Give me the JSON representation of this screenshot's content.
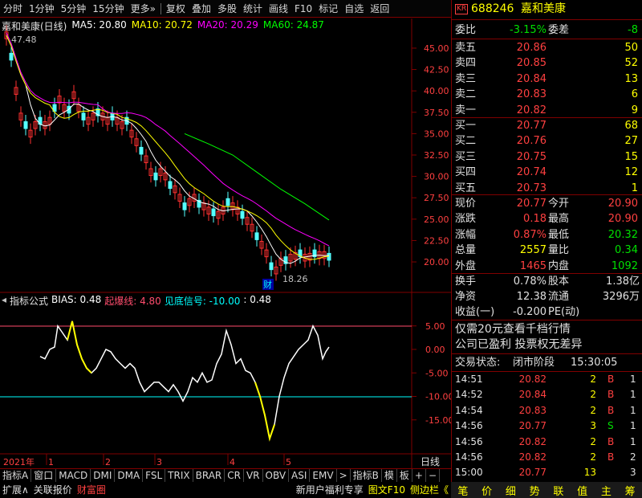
{
  "toolbar": {
    "items": [
      "分时",
      "1分钟",
      "5分钟",
      "15分钟",
      "更多»",
      "复权",
      "叠加",
      "多股",
      "统计",
      "画线",
      "F10",
      "标记",
      "自选",
      "返回"
    ]
  },
  "main_legend": {
    "stock": "嘉和美康(日线)",
    "ma5": "MA5: 20.80",
    "ma10": "MA10: 20.72",
    "ma20": "MA20: 20.29",
    "ma60": "MA60: 24.87",
    "high_label": "47.48",
    "low_label": "18.26",
    "marker": "财"
  },
  "colors": {
    "ma5": "#ffffff",
    "ma10": "#ffff00",
    "ma20": "#ff00ff",
    "ma60": "#00ff00",
    "up": "#ff3030",
    "down": "#54ffff",
    "grid": "#800000"
  },
  "price_axis": [
    "45.00",
    "42.50",
    "40.00",
    "37.50",
    "35.00",
    "32.50",
    "30.00",
    "27.50",
    "25.00",
    "22.50",
    "20.00"
  ],
  "ind_legend": {
    "name": "指标公式",
    "bias": "BIAS: 0.48",
    "qibao": "起爆线: 4.80",
    "jiandi": "见底信号: -10.00",
    "val": ": 0.48"
  },
  "ind_axis": [
    "5.00",
    "0.00",
    "-5.00",
    "-10.00",
    "-15.00"
  ],
  "time_axis": {
    "year": "2021年",
    "months": [
      "1",
      "2",
      "3",
      "4",
      "5"
    ],
    "period": "日线"
  },
  "chart_data": {
    "type": "line",
    "title": "嘉和美康(日线)",
    "price_ylim": [
      17,
      48
    ],
    "series": [
      {
        "name": "MA5",
        "values": [
          20.5,
          20.8
        ]
      },
      {
        "name": "MA10",
        "values": [
          20.4,
          20.72
        ]
      },
      {
        "name": "MA20",
        "values": [
          20.0,
          20.29
        ]
      },
      {
        "name": "MA60",
        "values": [
          35.0,
          24.87
        ]
      },
      {
        "name": "BIAS",
        "values": [
          0.48
        ]
      }
    ],
    "high": 47.48,
    "low": 18.26,
    "bias_lines": {
      "qibao": 4.8,
      "jiandi": -10
    }
  },
  "bottom_tabs": [
    "指标A",
    "窗口",
    "MACD",
    "DMI",
    "DMA",
    "FSL",
    "TRIX",
    "BRAR",
    "CR",
    "VR",
    "OBV",
    "ASI",
    "EMV",
    ">",
    "指标B",
    "模",
    "板",
    "+",
    "−"
  ],
  "bottom_bar": [
    "扩展∧",
    "关联报价",
    "财富圈",
    "新用户福利专享",
    "图文F10",
    "侧边栏《"
  ],
  "quote": {
    "badge": "KR",
    "code": "688246",
    "name": "嘉和美康",
    "weibi_label": "委比",
    "weibi": "-3.15%",
    "weicha_label": "委差",
    "weicha": "-8",
    "sell": [
      {
        "label": "卖五",
        "price": "20.86",
        "vol": "50"
      },
      {
        "label": "卖四",
        "price": "20.85",
        "vol": "52"
      },
      {
        "label": "卖三",
        "price": "20.84",
        "vol": "13"
      },
      {
        "label": "卖二",
        "price": "20.83",
        "vol": "6"
      },
      {
        "label": "卖一",
        "price": "20.82",
        "vol": "9"
      }
    ],
    "buy": [
      {
        "label": "买一",
        "price": "20.77",
        "vol": "68"
      },
      {
        "label": "买二",
        "price": "20.76",
        "vol": "27"
      },
      {
        "label": "买三",
        "price": "20.75",
        "vol": "15"
      },
      {
        "label": "买四",
        "price": "20.74",
        "vol": "12"
      },
      {
        "label": "买五",
        "price": "20.73",
        "vol": "1"
      }
    ],
    "stats": [
      {
        "l1": "现价",
        "v1": "20.77",
        "l2": "今开",
        "v2": "20.90"
      },
      {
        "l1": "涨跌",
        "v1": "0.18",
        "l2": "最高",
        "v2": "20.90"
      },
      {
        "l1": "涨幅",
        "v1": "0.87%",
        "l2": "最低",
        "v2": "20.32"
      },
      {
        "l1": "总量",
        "v1": "2557",
        "l2": "量比",
        "v2": "0.34"
      },
      {
        "l1": "外盘",
        "v1": "1465",
        "l2": "内盘",
        "v2": "1092"
      }
    ],
    "stats2": [
      {
        "l1": "换手",
        "v1": "0.78%",
        "l2": "股本",
        "v2": "1.38亿"
      },
      {
        "l1": "净资",
        "v1": "12.38",
        "l2": "流通",
        "v2": "3296万"
      },
      {
        "l1": "收益(一)",
        "v1": "-0.200",
        "l2": "PE(动)",
        "v2": ""
      }
    ],
    "promo1": "仅需20元查看千档行情",
    "promo2": "公司已盈利 投票权无差异",
    "status_label": "交易状态:",
    "status": "闭市阶段",
    "status_time": "15:30:05",
    "ticks": [
      {
        "t": "14:51",
        "p": "20.82",
        "v": "2",
        "f": "B",
        "n": "1"
      },
      {
        "t": "14:52",
        "p": "20.84",
        "v": "2",
        "f": "B",
        "n": "1"
      },
      {
        "t": "14:54",
        "p": "20.83",
        "v": "2",
        "f": "B",
        "n": "1"
      },
      {
        "t": "14:56",
        "p": "20.77",
        "v": "3",
        "f": "S",
        "n": "1"
      },
      {
        "t": "14:56",
        "p": "20.82",
        "v": "2",
        "f": "B",
        "n": "1"
      },
      {
        "t": "14:56",
        "p": "20.82",
        "v": "2",
        "f": "B",
        "n": "2"
      },
      {
        "t": "15:00",
        "p": "20.77",
        "v": "13",
        "f": "",
        "n": "3"
      }
    ],
    "tabs": [
      "笔",
      "价",
      "细",
      "势",
      "联",
      "值",
      "主",
      "筹"
    ]
  }
}
